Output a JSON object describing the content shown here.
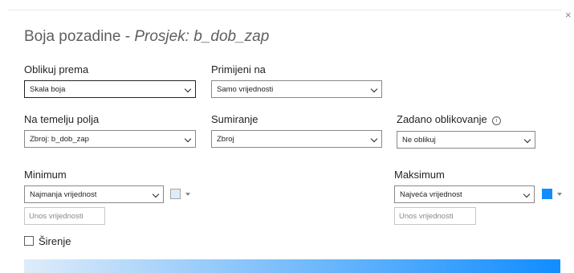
{
  "dialog": {
    "title_prefix": "Boja pozadine - ",
    "title_italic": "Prosjek: b_dob_zap",
    "close_glyph": "×"
  },
  "format_by": {
    "label": "Oblikuj prema",
    "value": "Skala boja"
  },
  "apply_to": {
    "label": "Primijeni na",
    "value": "Samo vrijednosti"
  },
  "based_on_field": {
    "label": "Na temelju polja",
    "value": "Zbroj: b_dob_zap"
  },
  "summarization": {
    "label": "Sumiranje",
    "value": "Zbroj"
  },
  "default_formatting": {
    "label": "Zadano oblikovanje",
    "info_glyph": "i",
    "value": "Ne oblikuj"
  },
  "minimum": {
    "label": "Minimum",
    "type_value": "Najmanja vrijednost",
    "input_placeholder": "Unos vrijednosti",
    "color": "#deecf9"
  },
  "maximum": {
    "label": "Maksimum",
    "type_value": "Najveća vrijednost",
    "input_placeholder": "Unos vrijednosti",
    "color": "#118dff"
  },
  "diverging": {
    "label": "Širenje",
    "checked": false
  },
  "gradient_preview": {
    "from": "#deecf9",
    "to": "#118dff"
  }
}
